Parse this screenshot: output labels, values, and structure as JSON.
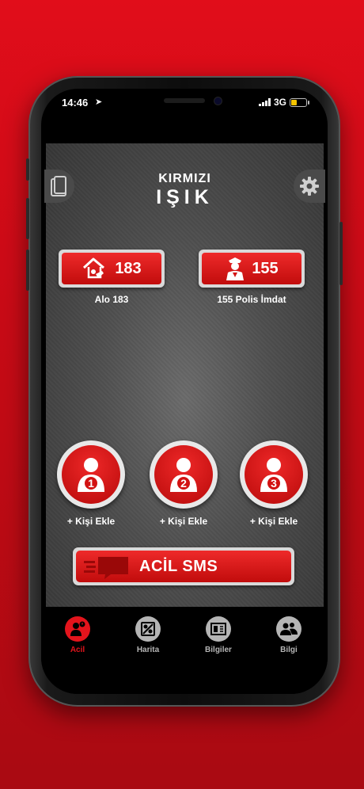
{
  "status": {
    "time": "14:46",
    "network": "3G"
  },
  "app": {
    "logo_line1": "KIRMIZI",
    "logo_line2": "IŞIK",
    "hotlines": [
      {
        "number": "183",
        "label": "Alo 183"
      },
      {
        "number": "155",
        "label": "155 Polis İmdat"
      }
    ],
    "contacts": [
      {
        "index": "1",
        "label": "+ Kişi Ekle"
      },
      {
        "index": "2",
        "label": "+ Kişi Ekle"
      },
      {
        "index": "3",
        "label": "+ Kişi Ekle"
      }
    ],
    "sms_label": "ACİL SMS"
  },
  "tabs": [
    {
      "label": "Acil",
      "icon": "emergency-icon",
      "active": true
    },
    {
      "label": "Harita",
      "icon": "map-icon",
      "active": false
    },
    {
      "label": "Bilgiler",
      "icon": "book-icon",
      "active": false
    },
    {
      "label": "Bilgi",
      "icon": "people-icon",
      "active": false
    }
  ],
  "colors": {
    "accent": "#e3141c",
    "tab_inactive": "#b5b5b5"
  }
}
